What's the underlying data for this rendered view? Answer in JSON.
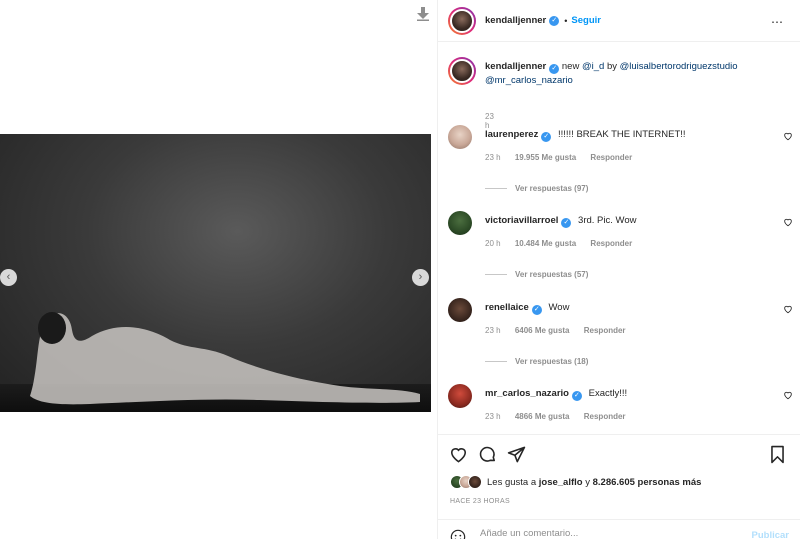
{
  "post": {
    "author": "kendalljenner",
    "follow_label": "Seguir",
    "separator": "•",
    "verified_mark": "✓",
    "more_icon": "⋯",
    "caption_prefix": "new",
    "caption_tag": "@i_d",
    "caption_by": "by",
    "caption_link1": "@luisalbertorodriguezstudio",
    "caption_link2": "@mr_carlos_nazario",
    "caption_time": "23 h"
  },
  "media": {
    "prev_icon": "‹",
    "next_icon": "›"
  },
  "comments": [
    {
      "user": "laurenperez",
      "text": "!!!!!! BREAK THE INTERNET!!",
      "time": "23 h",
      "likes": "19.955 Me gusta",
      "reply": "Responder",
      "replies": "Ver respuestas (97)"
    },
    {
      "user": "victoriavillarroel",
      "text": "3rd. Pic. Wow",
      "time": "20 h",
      "likes": "10.484 Me gusta",
      "reply": "Responder",
      "replies": "Ver respuestas (57)"
    },
    {
      "user": "renellaice",
      "text": "Wow",
      "time": "23 h",
      "likes": "6406 Me gusta",
      "reply": "Responder",
      "replies": "Ver respuestas (18)"
    },
    {
      "user": "mr_carlos_nazario",
      "text": "Exactly!!!",
      "time": "23 h",
      "likes": "4866 Me gusta",
      "reply": "Responder"
    }
  ],
  "actions": {
    "likes_prefix": "Les gusta a",
    "likes_user": "jose_alflo",
    "likes_and": "y",
    "likes_count": "8.286.605 personas más",
    "timestamp": "HACE 23 HORAS",
    "comment_placeholder": "Añade un comentario...",
    "publish_label": "Publicar"
  },
  "colors": {
    "accent": "#0095f6",
    "verified": "#3897f0",
    "muted": "#8e8e8e"
  }
}
